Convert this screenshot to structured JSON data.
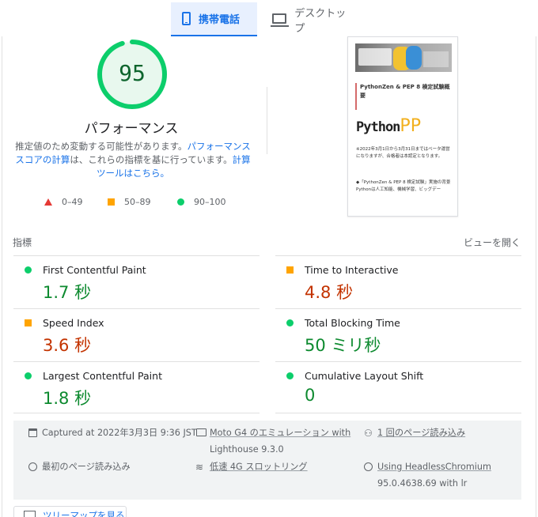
{
  "tabs": {
    "mobile": "携帯電話",
    "desktop": "デスクトップ"
  },
  "summary": {
    "score": "95",
    "title": "パフォーマンス",
    "desc_1": "推定値のため変動する可能性があります。",
    "link_calc": "パフォーマンス スコアの計算",
    "desc_2": "は、これらの指標を基に行っています。",
    "link_calculator": "計算ツールはこちら。",
    "score_fraction": 0.95,
    "colors": {
      "pass": "#0cce6b",
      "average": "#ffa400",
      "fail": "#e53935"
    }
  },
  "legend": [
    {
      "range": "0–49",
      "icon": "triangle-red"
    },
    {
      "range": "50–89",
      "icon": "square-orange"
    },
    {
      "range": "90–100",
      "icon": "circle-green"
    }
  ],
  "thumbnail": {
    "title": "PythonZen & PEP 8 検定試験概要",
    "logo_a": "Python",
    "logo_b": "PP",
    "para1": "※2022年3月1日から3月31日まではベータ運営になりますが、合格者は本認定となります。",
    "para2": "◆「PythonZen & PEP 8 検定試験」実施の背景",
    "para3": "Pythonは人工知能、機械学習、ビッグデー"
  },
  "metrics_header": {
    "label": "指標",
    "toggle": "ビューを開く"
  },
  "metrics": [
    {
      "name": "First Contentful Paint",
      "value": "1.7 秒",
      "status": "pass"
    },
    {
      "name": "Time to Interactive",
      "value": "4.8 秒",
      "status": "average"
    },
    {
      "name": "Speed Index",
      "value": "3.6 秒",
      "status": "average"
    },
    {
      "name": "Total Blocking Time",
      "value": "50 ミリ秒",
      "status": "pass"
    },
    {
      "name": "Largest Contentful Paint",
      "value": "1.8 秒",
      "status": "pass"
    },
    {
      "name": "Cumulative Layout Shift",
      "value": "0",
      "status": "pass"
    }
  ],
  "run_info": {
    "captured": "Captured at 2022年3月3日 9:36 JST",
    "device_1": "Moto G4 のエミュレーション with",
    "device_2": "Lighthouse 9.3.0",
    "page_loads": "1 回のページ読み込み",
    "initial_load": "最初のページ読み込み",
    "throttling": "低速 4G スロットリング",
    "browser_1": "Using HeadlessChromium",
    "browser_2": "95.0.4638.69 with lr"
  },
  "treemap_button": "ツリーマップを見る"
}
